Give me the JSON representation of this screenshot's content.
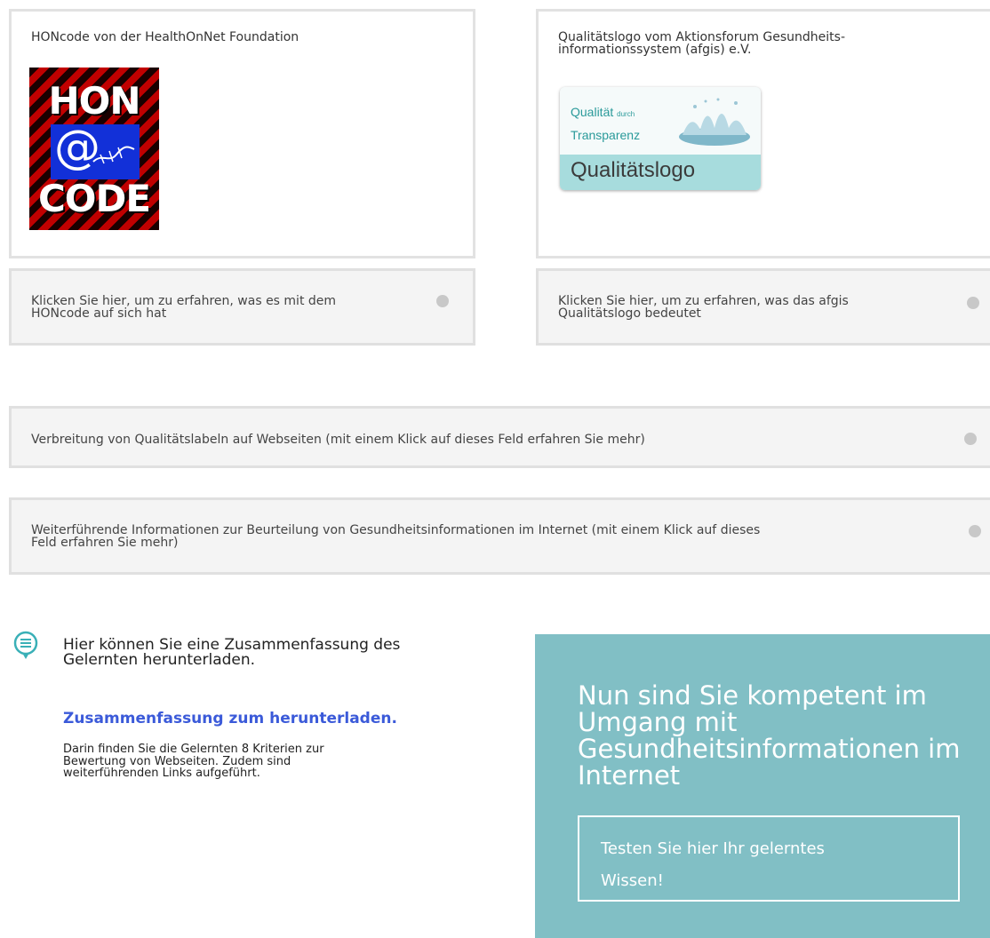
{
  "honcode_card": {
    "title": "HONcode von der HealthOnNet Foundation",
    "logo": {
      "line1": "HON",
      "line2": "@",
      "line3": "CODE"
    }
  },
  "afgis_card": {
    "title_line1": "Qualitätslogo vom Aktionsforum Gesundheits-",
    "title_line2": "informationssystem (afgis) e.V.",
    "logo": {
      "word1": "Qualität",
      "word_small": "durch",
      "word2": "Transparenz",
      "bottom": "Qualitätslogo"
    }
  },
  "accordions": {
    "honcode": {
      "line1": "Klicken Sie hier, um zu erfahren, was es mit dem",
      "line2": "HONcode auf sich hat"
    },
    "afgis": {
      "line1": "Klicken Sie hier, um zu erfahren, was das afgis",
      "line2": "Qualitätslogo bedeutet"
    },
    "spread": {
      "line1": "Verbreitung von Qualitätslabeln auf Webseiten (mit einem Klick auf dieses Feld erfahren Sie mehr)"
    },
    "further": {
      "line1": "Weiterführende Informationen zur Beurteilung von Gesundheitsinformationen im Internet (mit einem Klick auf dieses",
      "line2": "Feld erfahren Sie mehr)"
    }
  },
  "summary": {
    "intro_line1": "Hier können Sie eine Zusammenfassung des",
    "intro_line2": "Gelernten herunterladen.",
    "link": "Zusammenfassung zum herunterladen.",
    "desc_line1": "Darin finden Sie die Gelernten 8 Kriterien zur",
    "desc_line2": "Bewertung von Webseiten. Zudem sind",
    "desc_line3": "weiterführenden Links aufgeführt."
  },
  "cta": {
    "title_line1": "Nun sind Sie kompetent im",
    "title_line2": "Umgang mit",
    "title_line3": "Gesundheitsinformationen im",
    "title_line4": "Internet",
    "button_line1": "Testen Sie hier Ihr gelerntes",
    "button_line2": "Wissen!"
  },
  "colors": {
    "teal_panel": "#81bfc5",
    "link_blue": "#3b5ad9",
    "accordion_bg": "#f4f4f4",
    "icon_teal": "#3ab0b7"
  },
  "icons": {
    "chat": "chat-bubble-icon",
    "accordion_toggle": "dot-icon"
  }
}
